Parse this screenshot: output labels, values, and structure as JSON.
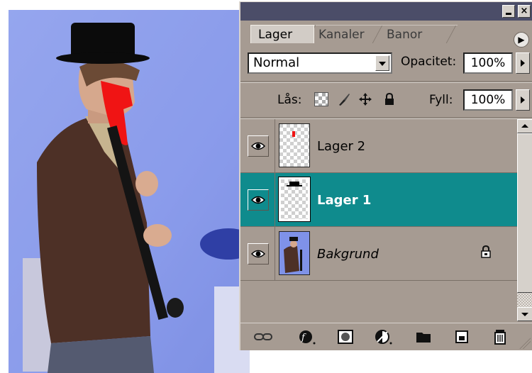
{
  "palette": {
    "tabs": [
      "Lager",
      "Kanaler",
      "Banor"
    ],
    "active_tab": "Lager",
    "blend_mode": "Normal",
    "opacity_label": "Opacitet:",
    "opacity_value": "100%",
    "lock_label": "Lås:",
    "fill_label": "Fyll:",
    "fill_value": "100%",
    "layers": [
      {
        "name": "Lager 2",
        "visible": true,
        "selected": false,
        "locked": false
      },
      {
        "name": "Lager 1",
        "visible": true,
        "selected": true,
        "locked": false
      },
      {
        "name": "Bakgrund",
        "visible": true,
        "selected": false,
        "locked": true
      }
    ],
    "bottom_icons": [
      "link-layers-icon",
      "layer-style-icon",
      "layer-mask-icon",
      "adjustment-layer-icon",
      "new-group-icon",
      "new-layer-icon",
      "trash-icon"
    ]
  },
  "colors": {
    "palette_bg": "#a69b92",
    "title_bar": "#4b4d68",
    "selected_layer": "#0f8b8d"
  }
}
